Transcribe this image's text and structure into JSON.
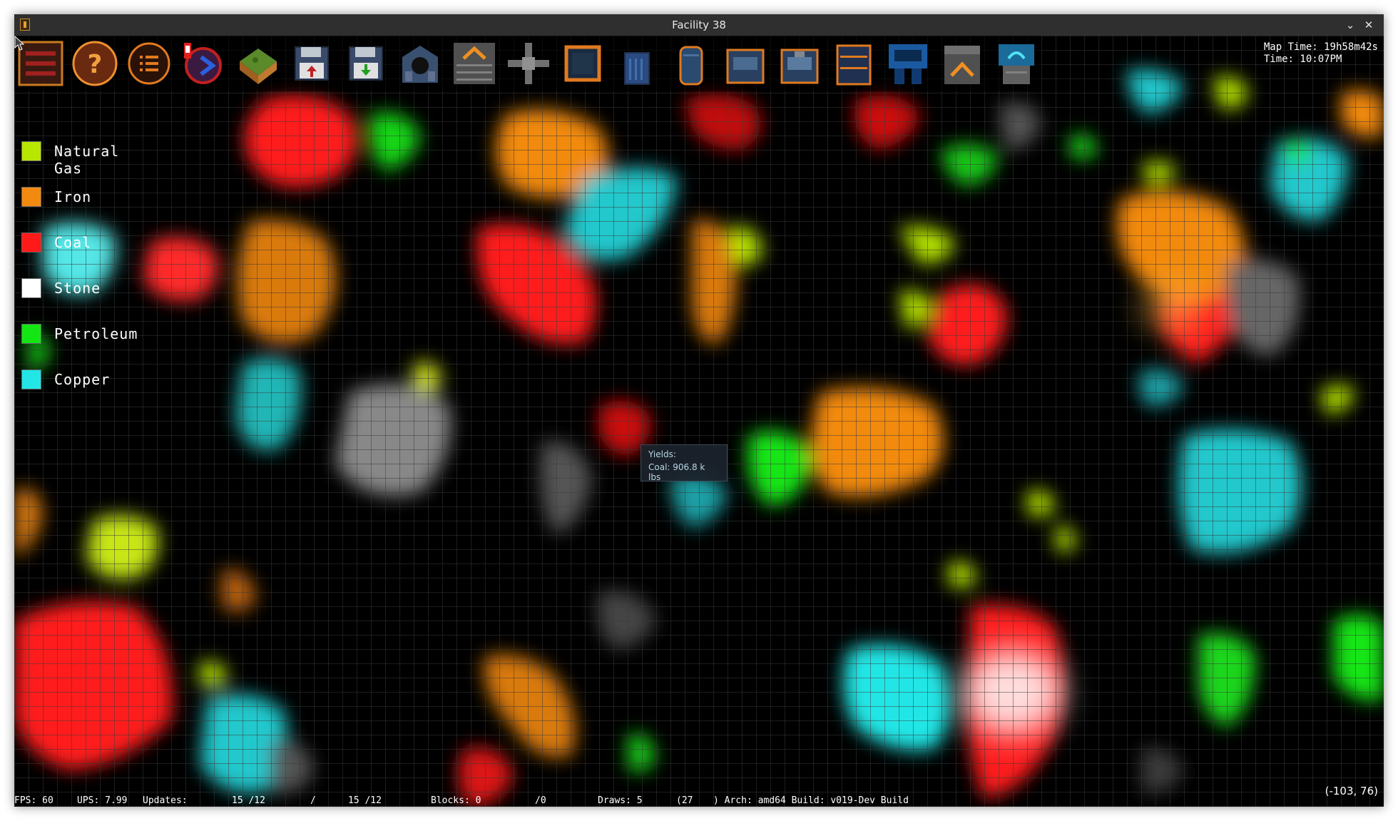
{
  "window": {
    "title": "Facility 38"
  },
  "toolbar": {
    "tools": [
      {
        "name": "main-menu-tool"
      },
      {
        "name": "help-tool"
      },
      {
        "name": "list-tool"
      },
      {
        "name": "alerts-tool"
      },
      {
        "name": "terrain-tool"
      },
      {
        "name": "save-upload-tool"
      },
      {
        "name": "save-download-tool"
      },
      {
        "name": "building-tool"
      },
      {
        "name": "conveyor-up-tool"
      },
      {
        "name": "junction-tool"
      },
      {
        "name": "pipe-loop-tool"
      },
      {
        "name": "tank-tool"
      },
      {
        "name": "silo-tool"
      },
      {
        "name": "assembler-tool"
      },
      {
        "name": "assembler-2-tool"
      },
      {
        "name": "shelf-tool"
      },
      {
        "name": "machine-tool"
      },
      {
        "name": "furnace-tool"
      },
      {
        "name": "extractor-tool"
      }
    ]
  },
  "clock": {
    "map_time": "Map Time: 19h58m42s",
    "time": "Time: 10:07PM"
  },
  "legend": {
    "items": [
      {
        "label": "Natural Gas",
        "color": "#b8e600"
      },
      {
        "label": "Iron",
        "color": "#f28a10"
      },
      {
        "label": "Coal",
        "color": "#ff1a1a"
      },
      {
        "label": "Stone",
        "color": "#ffffff"
      },
      {
        "label": "Petroleum",
        "color": "#14e614"
      },
      {
        "label": "Copper",
        "color": "#22e6e6"
      }
    ]
  },
  "tooltip": {
    "line1": "Yields:",
    "line2": "Coal: 906.8 k lbs"
  },
  "status": {
    "fps": "FPS: 60",
    "ups": "UPS: 7.99",
    "updates_label": "Updates:",
    "updates_a": "15 /12",
    "slash": "/",
    "updates_b": "15 /12",
    "blocks": "Blocks: 0",
    "blocks_total": "/0",
    "draws": "Draws: 5",
    "draws_paren": "(27",
    "arch": ") Arch: amd64 Build: v019-Dev Build"
  },
  "cursor_coords": "(-103, 76)"
}
